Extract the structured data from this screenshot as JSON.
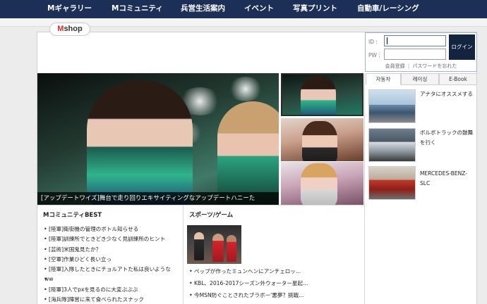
{
  "nav": {
    "items": [
      "Mギャラリー",
      "Mコミュニティ",
      "兵営生活案内",
      "イベント",
      "写真プリント",
      "自動車/レーシング"
    ]
  },
  "shop": {
    "m": "M",
    "rest": "shop"
  },
  "login": {
    "id_label": "ID :",
    "pw_label": "PW :",
    "button": "ログイン",
    "register": "会員登録",
    "separator": "|",
    "forgot": "パスワードを忘れた"
  },
  "hero": {
    "caption": "[アップデートワイズ]舞台で走り回りエキサイティングなアップデートハニーた"
  },
  "sidebar": {
    "tabs": [
      "자동차",
      "레이싱",
      "E-Book"
    ],
    "news": [
      {
        "text": "アナタにオススメする"
      },
      {
        "text": "ボルボトラックの鼓舞を行く"
      },
      {
        "text": "MERCEDES-BENZ- SLC"
      }
    ]
  },
  "community": {
    "title": "MコミュニティBEST",
    "items": [
      "[陸軍]衛街機の管理のボトル知らせる",
      "[陸軍]訓練所でときどき少なく見訓練所のヒント",
      "[芸術]米国鬼見たか？",
      "[空軍]作業ひどく長い立っ",
      "[陸軍]入隊したときにチョルアトた私は良いような",
      "ww",
      "[陸軍]3人でpxを見るのに大変ぶぶぶ",
      "[海兵隊]陣営に来て食べられたスナック"
    ]
  },
  "sports": {
    "title": "スポーツ/ゲーム",
    "items": [
      "ペップが作ったミュンヘンにアンチェロッ...",
      "KBL、2016-2017シーズン外ウォーター星起...",
      "今MSN防ぐことされたブラボー'悪夢？挑戦..."
    ]
  },
  "colors": {
    "nav_bg": "#1b2f57",
    "login_button": "#14233f",
    "shop_m": "#d62b2b"
  }
}
